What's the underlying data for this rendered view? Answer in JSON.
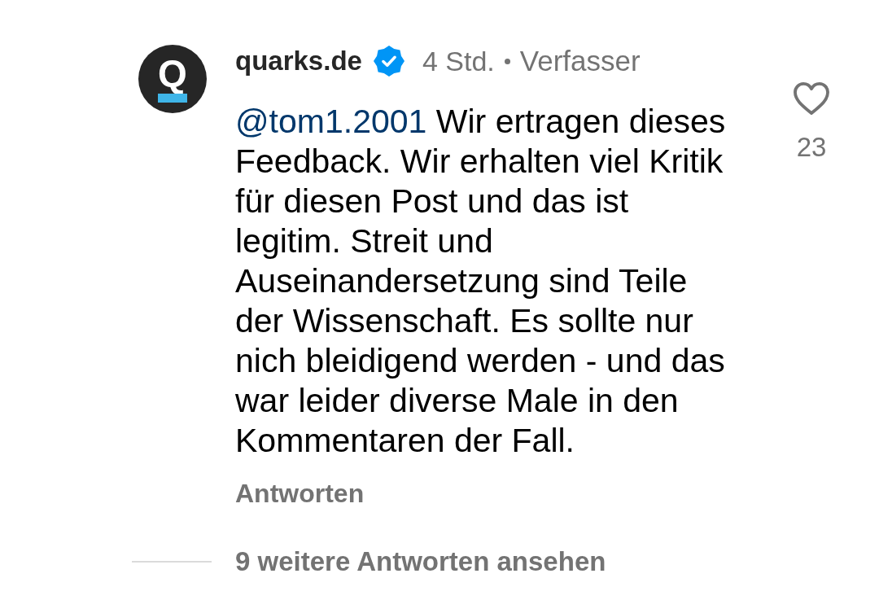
{
  "comment": {
    "avatar": {
      "letter": "Q"
    },
    "author": {
      "name": "quarks.de",
      "verified": true
    },
    "time": "4 Std.",
    "role": "Verfasser",
    "mention": "@tom1.2001",
    "text": "Wir ertragen dieses Feedback. Wir erhalten viel Kritik für diesen Post und das ist legitim. Streit und Auseinandersetzung sind Teile der Wissenschaft. Es sollte nur nich bleidigend werden - und das war leider diverse Male in den Kommentaren der Fall.",
    "reply": "Antworten",
    "likes": {
      "liked": false,
      "count": "23"
    }
  },
  "more_replies": "9 weitere Antworten ansehen"
}
